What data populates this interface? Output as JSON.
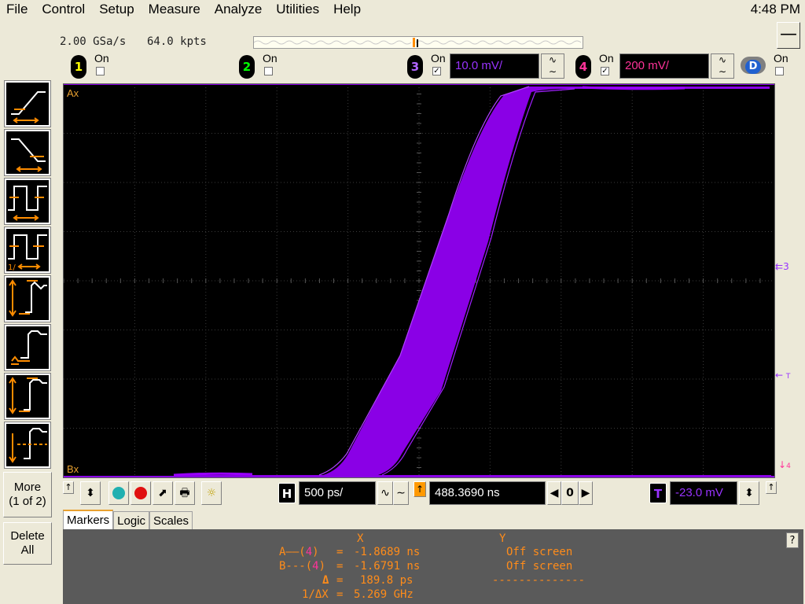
{
  "menu": {
    "items": [
      "File",
      "Control",
      "Setup",
      "Measure",
      "Analyze",
      "Utilities",
      "Help"
    ],
    "clock": "4:48 PM"
  },
  "acquisition": {
    "sample_rate": "2.00 GSa/s",
    "memory_depth": "64.0 kpts"
  },
  "channels": [
    {
      "num": "1",
      "on_label": "On",
      "checked": false,
      "color": "#ffff00"
    },
    {
      "num": "2",
      "on_label": "On",
      "checked": false,
      "color": "#00ff00"
    },
    {
      "num": "3",
      "on_label": "On",
      "checked": true,
      "scale": "10.0 mV/",
      "color": "#9933ff"
    },
    {
      "num": "4",
      "on_label": "On",
      "checked": true,
      "scale": "200 mV/",
      "color": "#ff3399"
    },
    {
      "num": "D",
      "on_label": "On",
      "checked": false,
      "color": "#3399ff"
    }
  ],
  "scope": {
    "cursor_a_label": "Ax",
    "cursor_b_label": "Bx",
    "waveform_color": "#9900ff",
    "right_markers": {
      "ch3": "3",
      "trigger": "T",
      "ch4": "4"
    }
  },
  "left_panel": {
    "more_label": "More",
    "more_page": "(1 of 2)",
    "delete_label": "Delete",
    "delete_label2": "All"
  },
  "horizontal": {
    "h_badge": "H",
    "timebase": "500 ps/",
    "position": "488.3690 ns",
    "zero_label": "0"
  },
  "trigger": {
    "t_badge": "T",
    "level": "-23.0 mV"
  },
  "tabs": [
    "Markers",
    "Logic",
    "Scales"
  ],
  "markers": {
    "col_x": "X",
    "col_y": "Y",
    "a_label": "A——(",
    "a_src": "4",
    "a_end": ")",
    "a_x": "-1.8689 ns",
    "a_y": "Off screen",
    "b_label": "B---(",
    "b_src": "4",
    "b_end": ")",
    "b_x": "-1.6791 ns",
    "b_y": "Off screen",
    "delta_label": "Δ",
    "delta_x": "189.8 ps",
    "delta_y": "--------------",
    "inv_label": "1/ΔX",
    "inv_x": "5.269 GHz",
    "equals": "="
  },
  "help_label": "?"
}
